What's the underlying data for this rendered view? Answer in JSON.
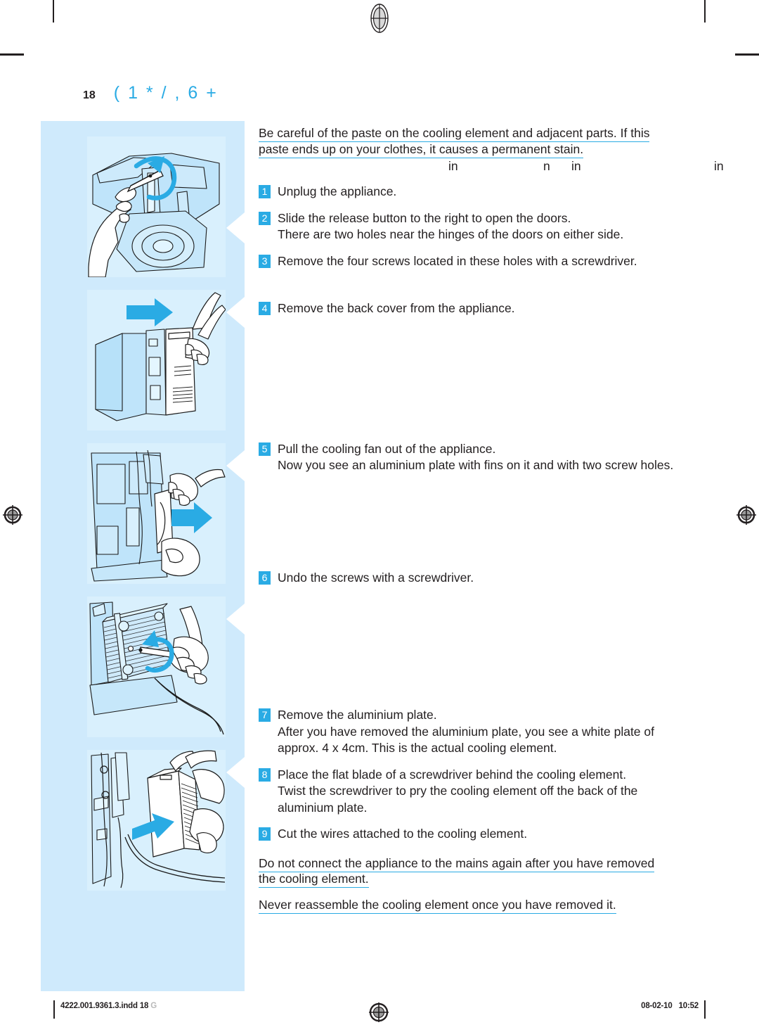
{
  "page": {
    "number": "18",
    "chapter_title": "( 1 * / , 6 +",
    "accent_color": "#2aabe4",
    "panel_bg": "#cfeafc",
    "illustration_bg": "#d9f0fd"
  },
  "warnings_top": {
    "line1": "Be careful of the paste on the cooling element and adjacent parts. If this",
    "line2": "paste ends up on your clothes, it causes a permanent stain.",
    "fragment_line": [
      "in",
      "n",
      "in",
      "in"
    ]
  },
  "steps": [
    {
      "number": "1",
      "text": "Unplug the appliance.",
      "sub": ""
    },
    {
      "number": "2",
      "text": "Slide the release button to the right to open the doors.",
      "sub": "There are two holes near the hinges of the doors on either side."
    },
    {
      "number": "3",
      "text": "Remove the four screws located in these holes with a screwdriver.",
      "sub": ""
    },
    {
      "number": "4",
      "text": "Remove the back cover from the appliance.",
      "sub": ""
    },
    {
      "number": "5",
      "text": "Pull the cooling fan out of the appliance.",
      "sub": "Now you see an aluminium plate with fins on it and with two screw holes."
    },
    {
      "number": "6",
      "text": "Undo the screws with a screwdriver.",
      "sub": ""
    },
    {
      "number": "7",
      "text": "Remove the aluminium plate.",
      "sub": "After you have removed the aluminium plate, you see a white plate of approx. 4 x 4cm. This is the actual cooling element."
    },
    {
      "number": "8",
      "text": "Place the flat blade of a screwdriver behind the cooling element.",
      "sub": "Twist the screwdriver to pry the cooling element off the back of the aluminium plate."
    },
    {
      "number": "9",
      "text": "Cut the wires attached to the cooling element.",
      "sub": ""
    }
  ],
  "warnings_bottom": {
    "line1": "Do not connect the appliance to the mains again after you have removed",
    "line2": "the cooling element.",
    "line3": "Never reassemble the cooling element once you have removed it."
  },
  "illustrations": [
    {
      "name": "unscrew-door-hinge-screws",
      "arrow": "rotate"
    },
    {
      "name": "remove-back-cover",
      "arrow": "right"
    },
    {
      "name": "pull-cooling-fan-out",
      "arrow": "right"
    },
    {
      "name": "undo-screws-aluminium-plate",
      "arrow": "rotate"
    },
    {
      "name": "remove-aluminium-plate",
      "arrow": "right"
    }
  ],
  "footer": {
    "file_name": "4222.001.9361.3.indd",
    "file_page": "18",
    "file_mark": "G",
    "date": "08-02-10",
    "time": "10:52"
  }
}
